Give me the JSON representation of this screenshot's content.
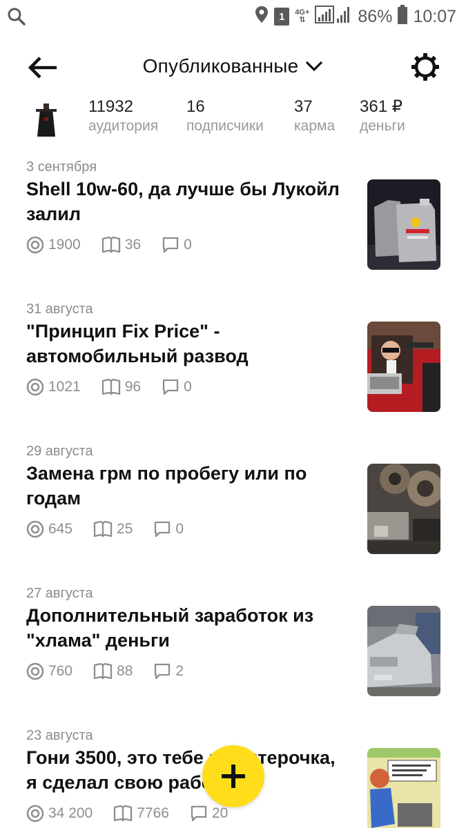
{
  "status_bar": {
    "sim_slot": "1",
    "network_type": "4G+",
    "battery_percent": "86%",
    "time": "10:07"
  },
  "header": {
    "title": "Опубликованные"
  },
  "stats": [
    {
      "value": "11932",
      "label": "аудитория"
    },
    {
      "value": "16",
      "label": "подписчики"
    },
    {
      "value": "37",
      "label": "карма"
    },
    {
      "value": "361 ₽",
      "label": "деньги"
    }
  ],
  "articles": [
    {
      "date": "3 сентября",
      "title": "Shell 10w-60, да лучше бы Лукойл залил",
      "views": "1900",
      "reads": "36",
      "comments": "0"
    },
    {
      "date": "31 августа",
      "title": "\"Принцип Fix Price\" - автомобильный развод",
      "views": "1021",
      "reads": "96",
      "comments": "0"
    },
    {
      "date": "29 августа",
      "title": "Замена грм по пробегу или по годам",
      "views": "645",
      "reads": "25",
      "comments": "0"
    },
    {
      "date": "27 августа",
      "title": "Дополнительный заработок из \"хлама\" деньги",
      "views": "760",
      "reads": "88",
      "comments": "2"
    },
    {
      "date": "23 августа",
      "title": "Гони 3500, это тебе не пятерочка, я сделал свою работу",
      "views": "34 200",
      "reads": "7766",
      "comments": "20"
    }
  ],
  "colors": {
    "fab": "#ffdd1a",
    "meta_text": "#8e8e8e"
  }
}
